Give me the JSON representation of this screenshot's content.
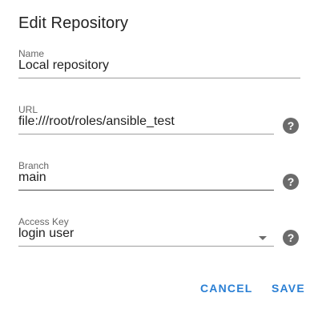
{
  "dialog": {
    "title": "Edit Repository"
  },
  "fields": {
    "name": {
      "label": "Name",
      "value": "Local repository"
    },
    "url": {
      "label": "URL",
      "value": "file:///root/roles/ansible_test"
    },
    "branch": {
      "label": "Branch",
      "value": "main"
    },
    "access_key": {
      "label": "Access Key",
      "value": "login user"
    }
  },
  "icons": {
    "help": "help-circle-icon",
    "dropdown": "arrow-drop-down-icon"
  },
  "help_glyph": "?",
  "actions": {
    "cancel": "CANCEL",
    "save": "SAVE"
  },
  "colors": {
    "accent": "#2a7fd4",
    "icon": "#6b6b6b"
  }
}
